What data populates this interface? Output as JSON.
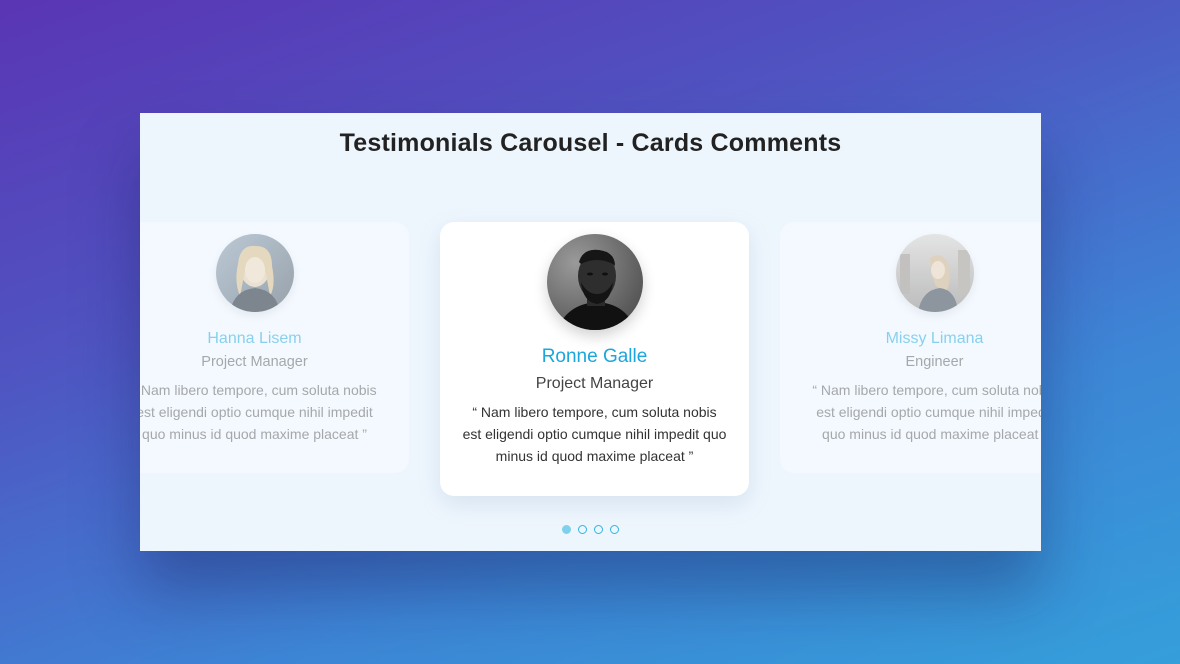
{
  "title": "Testimonials Carousel - Cards Comments",
  "testimonials": [
    {
      "name": "Hanna Lisem",
      "role": "Project Manager",
      "quote": "“ Nam libero tempore, cum soluta nobis est eligendi optio cumque nihil impedit quo minus id quod maxime placeat ”"
    },
    {
      "name": "Ronne Galle",
      "role": "Project Manager",
      "quote": "“ Nam libero tempore, cum soluta nobis est eligendi optio cumque nihil impedit quo minus id quod maxime placeat ”"
    },
    {
      "name": "Missy Limana",
      "role": "Engineer",
      "quote": "“ Nam libero tempore, cum soluta nobis est eligendi optio cumque nihil impedit quo minus id quod maxime placeat ”"
    }
  ],
  "pagination": {
    "total": 4,
    "active": 1
  },
  "colors": {
    "accent": "#1ba6dc",
    "panel_bg": "#eef6fd",
    "dot_active": "#7fd0ec"
  }
}
